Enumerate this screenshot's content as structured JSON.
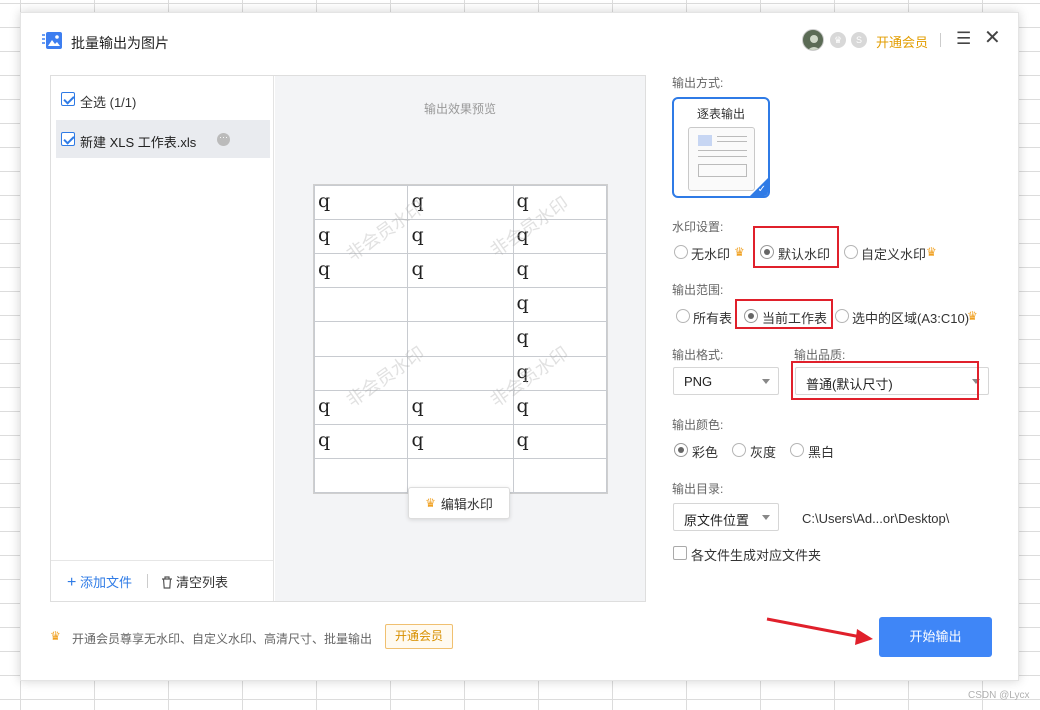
{
  "dialog": {
    "title": "批量输出为图片",
    "header": {
      "vip_label": "开通会员",
      "menu_icon": "menu-icon",
      "close_icon": "close-icon"
    }
  },
  "file_list": {
    "select_all_label": "全选 (1/1)",
    "files": [
      {
        "name": "新建 XLS 工作表.xls",
        "checked": true
      }
    ],
    "add_file_label": "添加文件",
    "clear_list_label": "清空列表"
  },
  "preview": {
    "title": "输出效果预览",
    "watermark_text": "非会员水印",
    "rows": [
      [
        "q",
        "q",
        "q"
      ],
      [
        "q",
        "q",
        "q"
      ],
      [
        "q",
        "q",
        "q"
      ],
      [
        "",
        "",
        "q"
      ],
      [
        "",
        "",
        "q"
      ],
      [
        "",
        "",
        "q"
      ],
      [
        "q",
        "q",
        "q"
      ],
      [
        "q",
        "q",
        "q"
      ],
      [
        "",
        "",
        ""
      ]
    ],
    "edit_watermark_label": "编辑水印"
  },
  "settings": {
    "output_mode": {
      "label": "输出方式:",
      "selected": "逐表输出"
    },
    "watermark": {
      "label": "水印设置:",
      "options": [
        {
          "label": "无水印",
          "selected": false,
          "vip": true
        },
        {
          "label": "默认水印",
          "selected": true,
          "vip": false
        },
        {
          "label": "自定义水印",
          "selected": false,
          "vip": true
        }
      ]
    },
    "range": {
      "label": "输出范围:",
      "options": [
        {
          "label": "所有表",
          "selected": false,
          "vip": false
        },
        {
          "label": "当前工作表",
          "selected": true,
          "vip": false
        },
        {
          "label": "选中的区域(A3:C10)",
          "selected": false,
          "vip": true
        }
      ]
    },
    "format": {
      "label": "输出格式:",
      "value": "PNG"
    },
    "quality": {
      "label": "输出品质:",
      "value": "普通(默认尺寸)"
    },
    "color": {
      "label": "输出颜色:",
      "options": [
        {
          "label": "彩色",
          "selected": true
        },
        {
          "label": "灰度",
          "selected": false
        },
        {
          "label": "黑白",
          "selected": false
        }
      ]
    },
    "directory": {
      "label": "输出目录:",
      "value": "原文件位置",
      "path": "C:\\Users\\Ad...or\\Desktop\\"
    },
    "subfolder": {
      "label": "各文件生成对应文件夹",
      "checked": false
    }
  },
  "footer": {
    "promo_text": "开通会员尊享无水印、自定义水印、高清尺寸、批量输出",
    "promo_button": "开通会员",
    "start_button": "开始输出"
  },
  "credit": "CSDN @Lycx",
  "colors": {
    "accent": "#3f86f7",
    "vip": "#e29d00",
    "annotation": "#e0202b"
  }
}
